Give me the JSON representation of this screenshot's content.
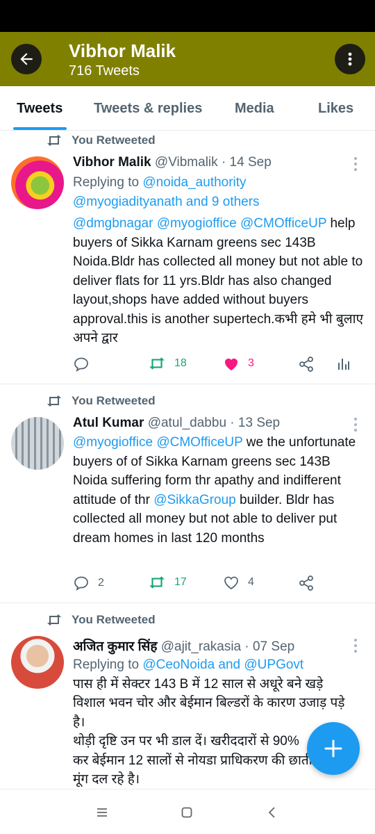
{
  "header": {
    "title": "Vibhor Malik",
    "subtitle": "716 Tweets",
    "back_icon": "arrow-left-icon",
    "more_icon": "more-vertical-icon",
    "bg_color": "#808000"
  },
  "tabs": [
    {
      "label": "Tweets",
      "active": true
    },
    {
      "label": "Tweets & replies",
      "active": false
    },
    {
      "label": "Media",
      "active": false
    },
    {
      "label": "Likes",
      "active": false
    }
  ],
  "tweets": [
    {
      "retweet_label": "You Retweeted",
      "name": "Vibhor Malik",
      "handle": "@Vibmalik",
      "date": "· 14 Sep",
      "reply_prefix": "Replying to",
      "reply_to": "@noida_authority",
      "reply_more": "@myogiadityanath and 9 others",
      "mentions": "@dmgbnagar @myogioffice @CMOfficeUP",
      "text": "help buyers of Sikka Karnam greens sec 143B Noida.Bldr has collected all money but not able to deliver flats for 11 yrs.Bldr has also changed layout,shops have added without buyers approval.this is another supertech.कभी हमे भी बुलाए अपने द्वार",
      "replies": "",
      "retweets": "18",
      "likes": "3",
      "liked": true,
      "avatar_desc": "flowers"
    },
    {
      "retweet_label": "You Retweeted",
      "name": "Atul Kumar",
      "handle": "@atul_dabbu",
      "date": "· 13 Sep",
      "mention1": "@myogioffice @CMOfficeUP",
      "text1": " we the unfortunate buyers of of Sikka Karnam greens sec 143B Noida suffering form thr apathy and indifferent attitude of thr ",
      "mention2": "@SikkaGroup",
      "text2": " builder. Bldr has collected all money but not able to deliver put dream homes in last 120 months",
      "replies": "2",
      "retweets": "17",
      "likes": "4",
      "liked": false,
      "avatar_desc": "building"
    },
    {
      "retweet_label": "You Retweeted",
      "name": "अजित कुमार सिंह",
      "handle": "@ajit_rakasia",
      "date": "· 07 Sep",
      "reply_prefix": "Replying to",
      "reply_to": "@CeoNoida and @UPGovt",
      "text": "पास ही में सेक्टर 143 B में 12 साल से अधूरे बने खड़े विशाल भवन चोर और बेईमान बिल्डरों के कारण उजाड़ पड़े है।",
      "text2": "थोड़ी दृष्टि उन पर भी डाल दें। खरीददारों से 90%",
      "text3": "कर बेईमान 12 सालों से नोयडा प्राधिकरण की छाती",
      "text4": "मूंग दल रहे है।"
    }
  ],
  "icons": {
    "reply": "reply-icon",
    "retweet": "retweet-icon",
    "like": "heart-icon",
    "share": "share-icon",
    "analytics": "analytics-icon",
    "compose": "plus-icon"
  },
  "colors": {
    "accent": "#1d9bf0",
    "retweet": "#17a673",
    "like": "#f91880",
    "muted": "#536471"
  }
}
